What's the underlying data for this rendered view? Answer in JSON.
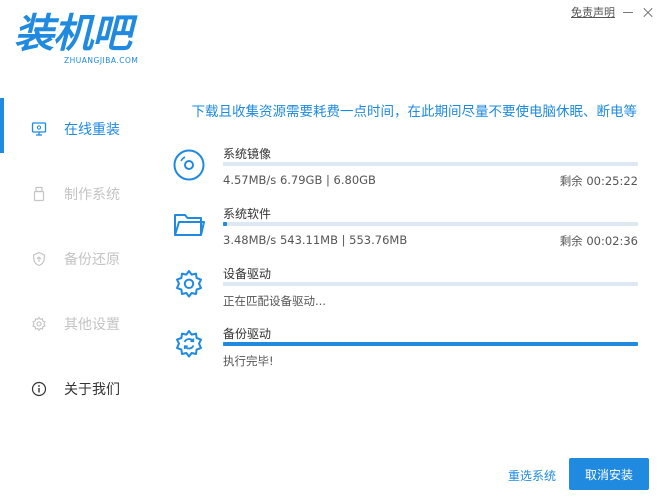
{
  "header": {
    "disclaimer": "免责声明",
    "logo_text": "装机吧",
    "logo_sub": "ZHUANGJIBA.COM"
  },
  "sidebar": {
    "items": [
      {
        "label": "在线重装",
        "icon": "monitor-icon",
        "active": true
      },
      {
        "label": "制作系统",
        "icon": "usb-icon"
      },
      {
        "label": "备份还原",
        "icon": "shield-icon"
      },
      {
        "label": "其他设置",
        "icon": "gear-icon"
      },
      {
        "label": "关于我们",
        "icon": "info-icon"
      }
    ]
  },
  "main": {
    "notice": "下载且收集资源需要耗费一点时间，在此期间尽量不要使电脑休眠、断电等",
    "tasks": [
      {
        "name": "系统镜像",
        "icon": "disc-icon",
        "progress": 0,
        "stat": "4.57MB/s 6.79GB | 6.80GB",
        "remain": "剩余 00:25:22"
      },
      {
        "name": "系统软件",
        "icon": "folder-icon",
        "progress": 0.01,
        "stat": "3.48MB/s 543.11MB | 553.76MB",
        "remain": "剩余 00:02:36"
      },
      {
        "name": "设备驱动",
        "icon": "gear-icon",
        "progress": 0,
        "stat": "正在匹配设备驱动...",
        "remain": ""
      },
      {
        "name": "备份驱动",
        "icon": "sync-gear-icon",
        "progress": 1.0,
        "stat": "执行完毕!",
        "remain": ""
      }
    ]
  },
  "footer": {
    "reselect_label": "重选系统",
    "cancel_label": "取消安装"
  },
  "colors": {
    "accent": "#1f8ae0",
    "track": "#dde8f3",
    "inactive_text": "#c4c4c4"
  }
}
